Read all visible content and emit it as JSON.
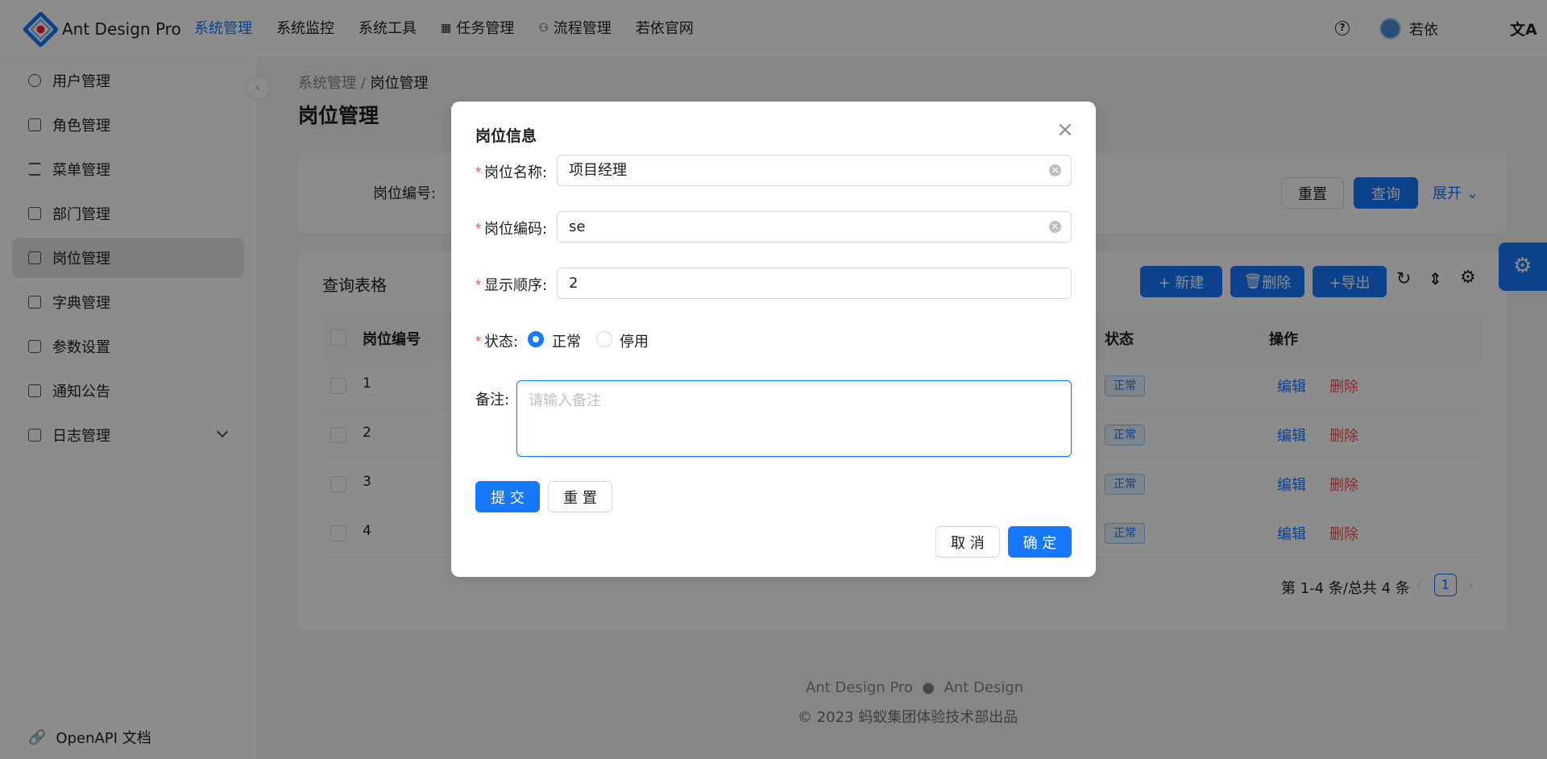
{
  "header": {
    "brand": "Ant Design Pro",
    "nav": [
      {
        "label": "系统管理",
        "active": true
      },
      {
        "label": "系统监控"
      },
      {
        "label": "系统工具"
      },
      {
        "label": "任务管理"
      },
      {
        "label": "流程管理"
      },
      {
        "label": "若依官网"
      }
    ],
    "user": "若依",
    "lang_icon": "文A"
  },
  "sidebar": {
    "items": [
      {
        "label": "用户管理",
        "icon": "user-icon"
      },
      {
        "label": "角色管理",
        "icon": "profile-icon"
      },
      {
        "label": "菜单管理",
        "icon": "menu-icon"
      },
      {
        "label": "部门管理",
        "icon": "cluster-icon"
      },
      {
        "label": "岗位管理",
        "icon": "appstore-icon",
        "selected": true
      },
      {
        "label": "字典管理",
        "icon": "book-icon"
      },
      {
        "label": "参数设置",
        "icon": "setting-list-icon"
      },
      {
        "label": "通知公告",
        "icon": "notification-icon"
      },
      {
        "label": "日志管理",
        "icon": "log-icon"
      }
    ],
    "openapi": "OpenAPI 文档",
    "collapse": "‹"
  },
  "breadcrumb": {
    "parent": "系统管理",
    "sep": "/",
    "current": "岗位管理"
  },
  "page_title": "岗位管理",
  "search": {
    "label": "岗位编号:",
    "reset": "重置",
    "query": "查询",
    "expand": "展开"
  },
  "table": {
    "title": "查询表格",
    "new": "+ 新建",
    "delete": "删除",
    "export": "+导出",
    "columns": {
      "code": "岗位编号",
      "status": "状态",
      "action": "操作"
    },
    "rows": [
      {
        "code": "1",
        "status": "正常",
        "edit": "编辑",
        "del": "删除"
      },
      {
        "code": "2",
        "status": "正常",
        "edit": "编辑",
        "del": "删除"
      },
      {
        "code": "3",
        "status": "正常",
        "edit": "编辑",
        "del": "删除"
      },
      {
        "code": "4",
        "status": "正常",
        "edit": "编辑",
        "del": "删除"
      }
    ],
    "pagination": {
      "summary": "第 1-4 条/总共 4 条",
      "page": "1"
    }
  },
  "footer": {
    "links": "Ant Design Pro",
    "link2": "Ant Design",
    "copyright": "2023 蚂蚁集团体验技术部出品"
  },
  "modal": {
    "title": "岗位信息",
    "close": "×",
    "name_label": "岗位名称:",
    "name_value": "项目经理",
    "code_label": "岗位编码:",
    "code_value": "se",
    "order_label": "显示顺序:",
    "order_value": "2",
    "status_label": "状态:",
    "status_normal": "正常",
    "status_disabled": "停用",
    "remark_label": "备注:",
    "remark_placeholder": "请输入备注",
    "submit": "提 交",
    "reset": "重 置",
    "cancel": "取 消",
    "ok": "确 定"
  },
  "colors": {
    "primary": "#1677ff",
    "danger": "#ff4d4f",
    "mask": "rgba(0,0,0,0.45)"
  }
}
